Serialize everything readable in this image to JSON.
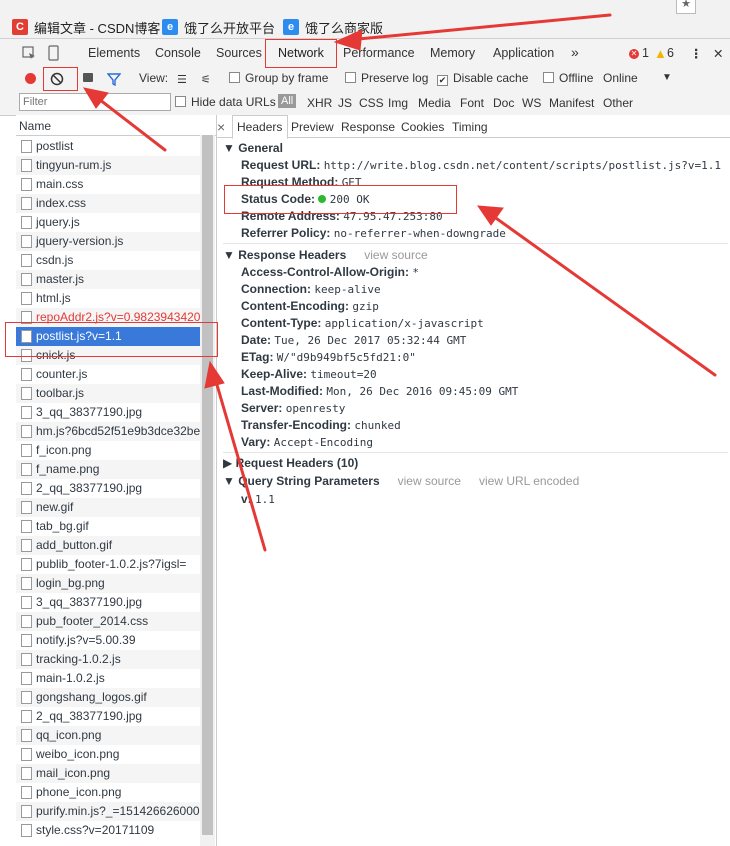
{
  "bookmarks": [
    {
      "label": "编辑文章 - CSDN博客",
      "icon": "csdn-logo-icon",
      "color": "#e33e33"
    },
    {
      "label": "饿了么开放平台",
      "icon": "eleme-icon",
      "color": "#2d8cf0"
    },
    {
      "label": "饿了么商家版",
      "icon": "eleme-icon",
      "color": "#2d8cf0"
    }
  ],
  "devtools": {
    "tabs": [
      "Elements",
      "Console",
      "Sources",
      "Network",
      "Performance",
      "Memory",
      "Application"
    ],
    "active_tab": "Network",
    "more": "»",
    "errors": "1",
    "warnings": "6",
    "menu": "⋮",
    "close": "✕"
  },
  "toolbar": {
    "view_label": "View:",
    "group_by_frame": "Group by frame",
    "preserve_log": "Preserve log",
    "disable_cache": "Disable cache",
    "offline": "Offline",
    "throttle": "Online"
  },
  "filter": {
    "placeholder": "Filter",
    "hide_data_urls": "Hide data URLs",
    "types": [
      "All",
      "XHR",
      "JS",
      "CSS",
      "Img",
      "Media",
      "Font",
      "Doc",
      "WS",
      "Manifest",
      "Other"
    ]
  },
  "requests": {
    "header": "Name",
    "items": [
      {
        "name": "postlist",
        "style": "normal"
      },
      {
        "name": "tingyun-rum.js",
        "style": "normal"
      },
      {
        "name": "main.css",
        "style": "normal"
      },
      {
        "name": "index.css",
        "style": "normal"
      },
      {
        "name": "jquery.js",
        "style": "normal"
      },
      {
        "name": "jquery-version.js",
        "style": "normal"
      },
      {
        "name": "csdn.js",
        "style": "normal"
      },
      {
        "name": "master.js",
        "style": "normal"
      },
      {
        "name": "html.js",
        "style": "normal"
      },
      {
        "name": "repoAddr2.js?v=0.9823943420",
        "style": "error"
      },
      {
        "name": "postlist.js?v=1.1",
        "style": "selected"
      },
      {
        "name": "cnick.js",
        "style": "normal"
      },
      {
        "name": "counter.js",
        "style": "normal"
      },
      {
        "name": "toolbar.js",
        "style": "normal"
      },
      {
        "name": "3_qq_38377190.jpg",
        "style": "normal"
      },
      {
        "name": "hm.js?6bcd52f51e9b3dce32bec",
        "style": "normal"
      },
      {
        "name": "f_icon.png",
        "style": "normal"
      },
      {
        "name": "f_name.png",
        "style": "normal"
      },
      {
        "name": "2_qq_38377190.jpg",
        "style": "normal"
      },
      {
        "name": "new.gif",
        "style": "normal"
      },
      {
        "name": "tab_bg.gif",
        "style": "normal"
      },
      {
        "name": "add_button.gif",
        "style": "normal"
      },
      {
        "name": "publib_footer-1.0.2.js?7igsl=",
        "style": "normal"
      },
      {
        "name": "login_bg.png",
        "style": "normal"
      },
      {
        "name": "3_qq_38377190.jpg",
        "style": "normal"
      },
      {
        "name": "pub_footer_2014.css",
        "style": "normal"
      },
      {
        "name": "notify.js?v=5.00.39",
        "style": "normal"
      },
      {
        "name": "tracking-1.0.2.js",
        "style": "normal"
      },
      {
        "name": "main-1.0.2.js",
        "style": "normal"
      },
      {
        "name": "gongshang_logos.gif",
        "style": "normal"
      },
      {
        "name": "2_qq_38377190.jpg",
        "style": "normal"
      },
      {
        "name": "qq_icon.png",
        "style": "normal"
      },
      {
        "name": "weibo_icon.png",
        "style": "normal"
      },
      {
        "name": "mail_icon.png",
        "style": "normal"
      },
      {
        "name": "phone_icon.png",
        "style": "normal"
      },
      {
        "name": "purify.min.js?_=151426626000",
        "style": "normal"
      },
      {
        "name": "style.css?v=20171109",
        "style": "normal"
      }
    ]
  },
  "detail": {
    "tabs": [
      "Headers",
      "Preview",
      "Response",
      "Cookies",
      "Timing"
    ],
    "active_tab": "Headers",
    "general": {
      "title": "General",
      "rows": [
        {
          "k": "Request URL:",
          "v": "http://write.blog.csdn.net/content/scripts/postlist.js?v=1.1"
        },
        {
          "k": "Request Method:",
          "v": "GET"
        },
        {
          "k": "Status Code:",
          "v": "200 OK"
        },
        {
          "k": "Remote Address:",
          "v": "47.95.47.253:80"
        },
        {
          "k": "Referrer Policy:",
          "v": "no-referrer-when-downgrade"
        }
      ]
    },
    "response_headers": {
      "title": "Response Headers",
      "view_source": "view source",
      "rows": [
        {
          "k": "Access-Control-Allow-Origin:",
          "v": "*"
        },
        {
          "k": "Connection:",
          "v": "keep-alive"
        },
        {
          "k": "Content-Encoding:",
          "v": "gzip"
        },
        {
          "k": "Content-Type:",
          "v": "application/x-javascript"
        },
        {
          "k": "Date:",
          "v": "Tue, 26 Dec 2017 05:32:44 GMT"
        },
        {
          "k": "ETag:",
          "v": "W/\"d9b949bf5c5fd21:0\""
        },
        {
          "k": "Keep-Alive:",
          "v": "timeout=20"
        },
        {
          "k": "Last-Modified:",
          "v": "Mon, 26 Dec 2016 09:45:09 GMT"
        },
        {
          "k": "Server:",
          "v": "openresty"
        },
        {
          "k": "Transfer-Encoding:",
          "v": "chunked"
        },
        {
          "k": "Vary:",
          "v": "Accept-Encoding"
        }
      ]
    },
    "request_headers": {
      "title": "Request Headers (10)"
    },
    "query_string": {
      "title": "Query String Parameters",
      "view_source": "view source",
      "view_url_encoded": "view URL encoded",
      "rows": [
        {
          "k": "v:",
          "v": "1.1"
        }
      ]
    }
  },
  "colors": {
    "annotation": "#e53935",
    "selected_row": "#3879d9",
    "error_text": "#e53935"
  }
}
